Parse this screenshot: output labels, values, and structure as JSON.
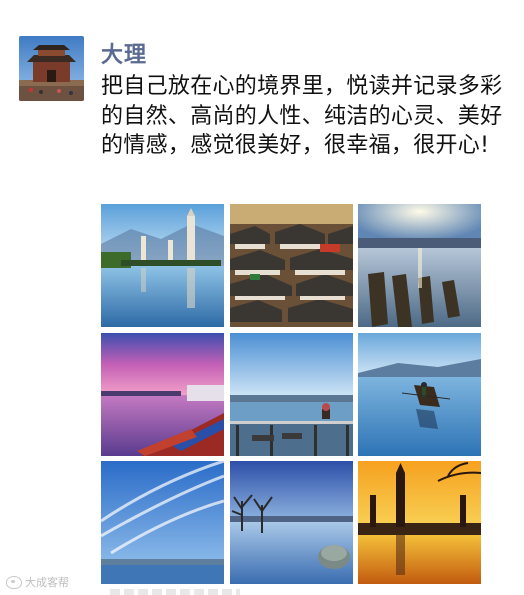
{
  "post": {
    "username": "大理",
    "text": "把自己放在心的境界里，悦读并记录多彩的自然、高尚的人性、纯洁的心灵、美好的情感，感觉很美好，很幸福，很开心!",
    "photos": [
      {
        "name": "three-pagodas-reflection-photo"
      },
      {
        "name": "old-town-rooftops-photo"
      },
      {
        "name": "lake-sunburst-boats-photo"
      },
      {
        "name": "pink-sunset-boats-photo"
      },
      {
        "name": "lakeside-table-chairs-photo"
      },
      {
        "name": "fisherman-boat-lake-photo"
      },
      {
        "name": "blue-sky-clouds-photo"
      },
      {
        "name": "trees-in-water-photo"
      },
      {
        "name": "golden-pagodas-sunset-photo"
      }
    ]
  },
  "watermark": {
    "text": "大成客帮"
  }
}
